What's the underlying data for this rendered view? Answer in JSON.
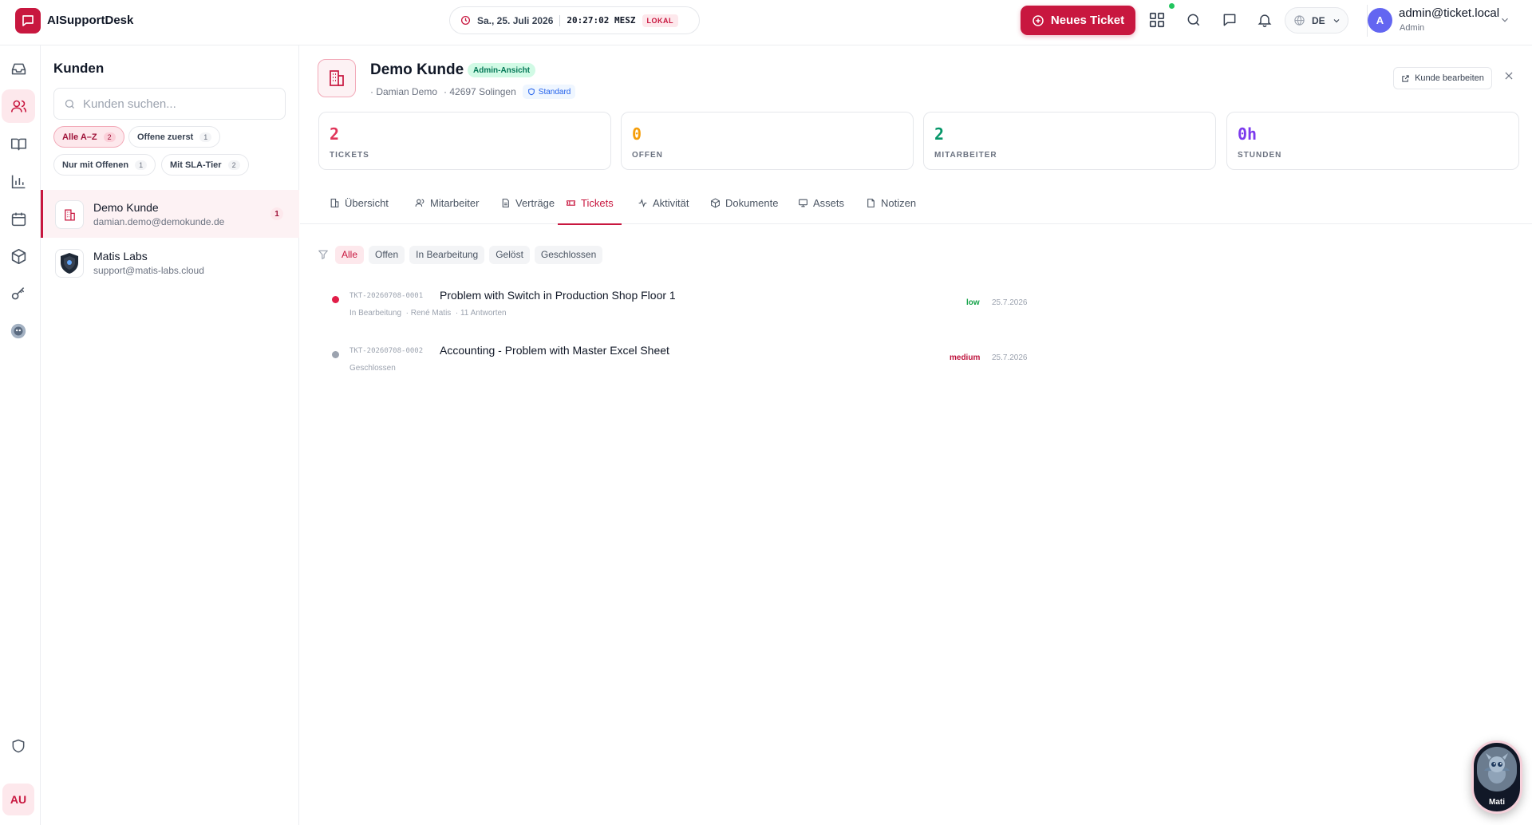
{
  "app": {
    "title": "AISupportDesk"
  },
  "clock": {
    "date": "Sa., 25. Juli 2026",
    "time": "20:27:02 MESZ",
    "mode": "LOKAL"
  },
  "header": {
    "new_ticket_label": "Neues Ticket",
    "language": "DE",
    "user": {
      "initial": "A",
      "email": "admin@ticket.local",
      "role": "Admin"
    }
  },
  "rail": {
    "items": [
      "inbox-icon",
      "customers-icon",
      "book-icon",
      "chart-icon",
      "calendar-icon",
      "box-icon",
      "key-icon",
      "dragon-icon"
    ],
    "active": "customers-icon",
    "bottom_shield": "shield-icon",
    "user_initials": "AU"
  },
  "panel": {
    "title": "Kunden",
    "search_placeholder": "Kunden suchen...",
    "chips": [
      {
        "label": "Alle A–Z",
        "count": "2",
        "active": true
      },
      {
        "label": "Offene zuerst",
        "count": "1",
        "active": false
      },
      {
        "label": "Nur mit Offenen",
        "count": "1",
        "active": false
      },
      {
        "label": "Mit SLA-Tier",
        "count": "2",
        "active": false
      }
    ],
    "customers": [
      {
        "name": "Demo Kunde",
        "email": "damian.demo@demokunde.de",
        "badge": "1"
      },
      {
        "name": "Matis Labs",
        "email": "support@matis-labs.cloud",
        "badge": ""
      }
    ]
  },
  "detail": {
    "name": "Demo Kunde",
    "view_badge": "Admin-Ansicht",
    "contact": "· Damian Demo",
    "location": "· 42697 Solingen",
    "tier": "Standard",
    "edit_label": "Kunde bearbeiten",
    "stats": [
      {
        "value": "2",
        "label": "TICKETS",
        "color": "#e0365a"
      },
      {
        "value": "0",
        "label": "OFFEN",
        "color": "#f59e0b"
      },
      {
        "value": "2",
        "label": "MITARBEITER",
        "color": "#059669"
      },
      {
        "value": "0h",
        "label": "STUNDEN",
        "color": "#7c3aed"
      }
    ],
    "tabs": [
      "Übersicht",
      "Mitarbeiter",
      "Verträge",
      "Tickets",
      "Aktivität",
      "Dokumente",
      "Assets",
      "Notizen"
    ],
    "active_tab": "Tickets",
    "filters": [
      "Alle",
      "Offen",
      "In Bearbeitung",
      "Gelöst",
      "Geschlossen"
    ],
    "active_filter": "Alle",
    "tickets": [
      {
        "id": "TKT-20260708-0001",
        "title": "Problem with Switch in Production Shop Floor 1",
        "status": "In Bearbeitung",
        "assignee": "· René Matis",
        "replies": "· 11 Antworten",
        "priority": "low",
        "priority_color": "#16a34a",
        "date": "25.7.2026",
        "dot_color": "#e11d48"
      },
      {
        "id": "TKT-20260708-0002",
        "title": "Accounting - Problem with Master Excel Sheet",
        "status": "Geschlossen",
        "assignee": "",
        "replies": "",
        "priority": "medium",
        "priority_color": "#be123c",
        "date": "25.7.2026",
        "dot_color": "#9ca3af"
      }
    ]
  },
  "assistant": {
    "name": "Mati"
  }
}
